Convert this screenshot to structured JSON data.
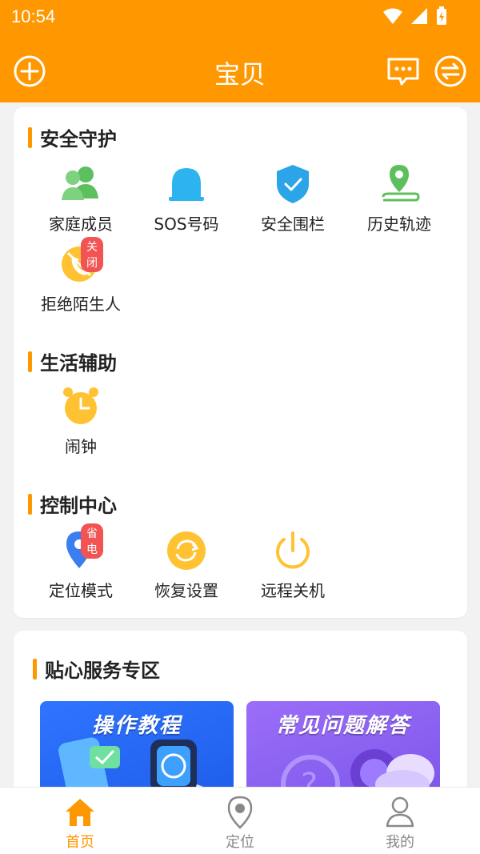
{
  "status": {
    "time": "10:54"
  },
  "header": {
    "title": "宝贝"
  },
  "colors": {
    "accent": "#ff9800",
    "badge": "#f25353",
    "green": "#5cc05e",
    "blue": "#2db4f0",
    "yellow": "#ffc233"
  },
  "sections": {
    "safety": {
      "title": "安全守护",
      "items": [
        {
          "label": "家庭成员",
          "icon": "family-icon"
        },
        {
          "label": "SOS号码",
          "icon": "bell-icon"
        },
        {
          "label": "安全围栏",
          "icon": "shield-icon"
        },
        {
          "label": "历史轨迹",
          "icon": "track-icon"
        },
        {
          "label": "拒绝陌生人",
          "icon": "reject-call-icon",
          "badge": "关闭"
        }
      ]
    },
    "life": {
      "title": "生活辅助",
      "items": [
        {
          "label": "闹钟",
          "icon": "alarm-icon"
        }
      ]
    },
    "control": {
      "title": "控制中心",
      "items": [
        {
          "label": "定位模式",
          "icon": "location-mode-icon",
          "badge": "省电"
        },
        {
          "label": "恢复设置",
          "icon": "restore-icon"
        },
        {
          "label": "远程关机",
          "icon": "power-icon"
        }
      ]
    }
  },
  "services": {
    "title": "贴心服务专区",
    "tiles": [
      {
        "title": "操作教程"
      },
      {
        "title": "常见问题解答"
      }
    ]
  },
  "nav": {
    "tabs": [
      {
        "label": "首页",
        "active": true
      },
      {
        "label": "定位",
        "active": false
      },
      {
        "label": "我的",
        "active": false
      }
    ]
  }
}
